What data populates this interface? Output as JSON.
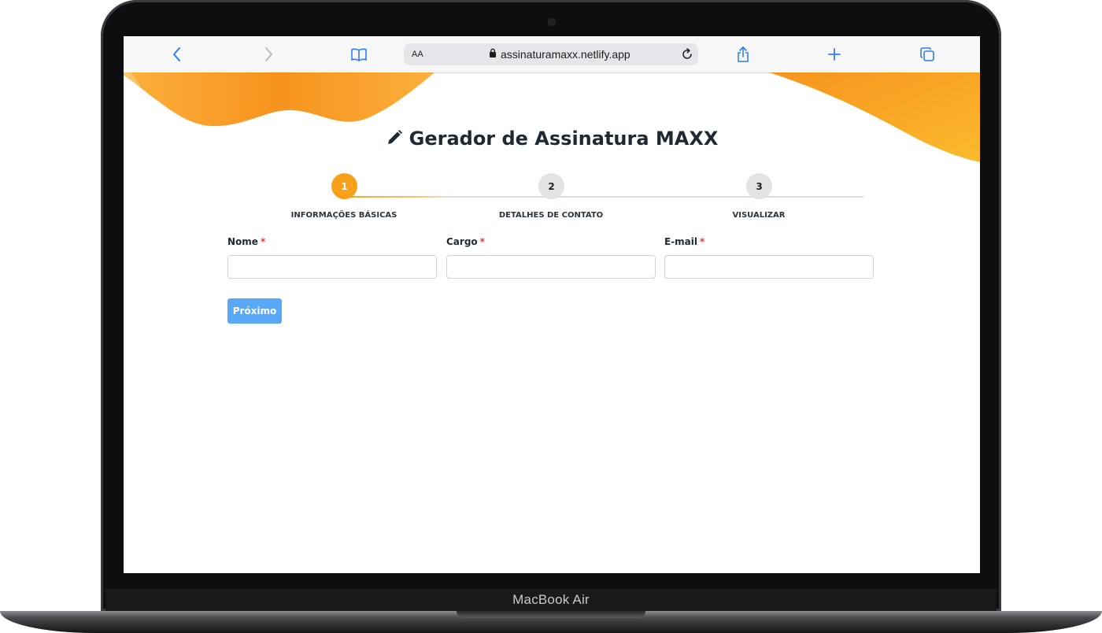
{
  "device": {
    "label": "MacBook Air"
  },
  "browser": {
    "text_size_label": "AA",
    "url": "assinaturamaxx.netlify.app",
    "icons": {
      "back": "chevron-left-icon",
      "forward": "chevron-right-icon",
      "bookmarks": "book-icon",
      "lock": "lock-icon",
      "reload": "reload-icon",
      "share": "share-icon",
      "new_tab": "plus-icon",
      "tabs": "tabs-icon"
    }
  },
  "page": {
    "title": "Gerador de Assinatura MAXX",
    "title_icon": "pencil-icon",
    "accent_color": "#f7a11b",
    "steps": [
      {
        "number": "1",
        "label": "INFORMAÇÕES BÁSICAS",
        "active": true
      },
      {
        "number": "2",
        "label": "DETALHES DE CONTATO",
        "active": false
      },
      {
        "number": "3",
        "label": "VISUALIZAR",
        "active": false
      }
    ],
    "form": {
      "fields": [
        {
          "label": "Nome",
          "required_mark": "*",
          "value": ""
        },
        {
          "label": "Cargo",
          "required_mark": "*",
          "value": ""
        },
        {
          "label": "E-mail",
          "required_mark": "*",
          "value": ""
        }
      ],
      "next_label": "Próximo",
      "button_color": "#58a8f8"
    }
  }
}
